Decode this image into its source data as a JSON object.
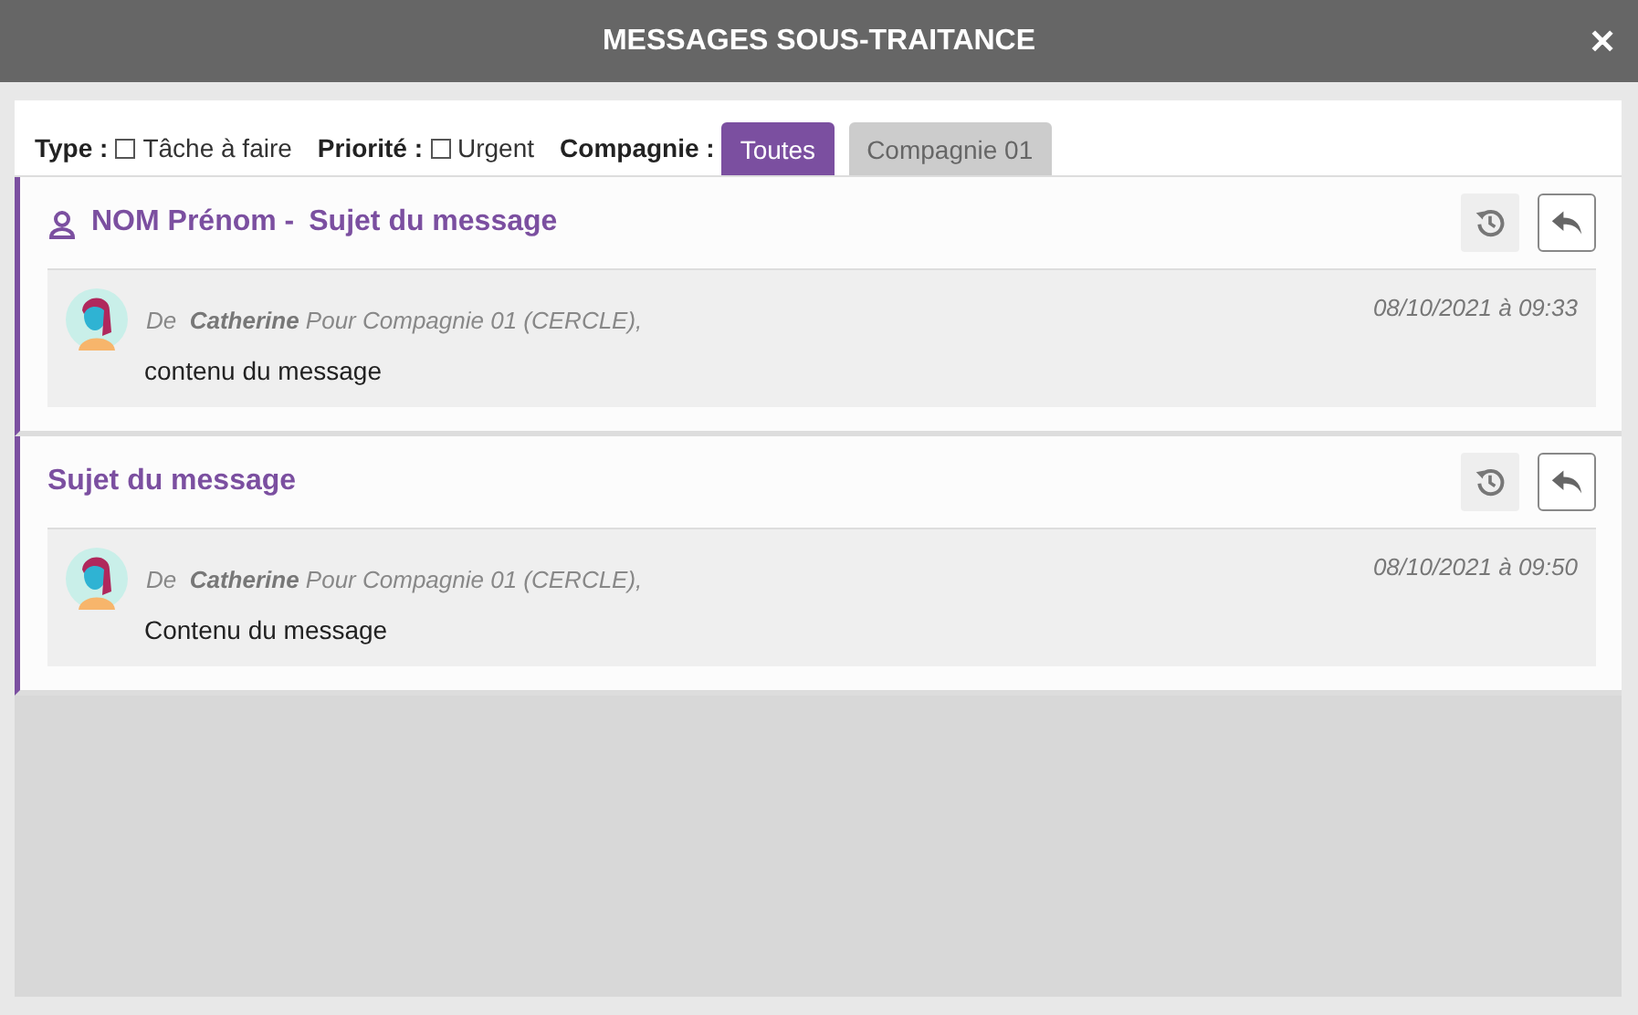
{
  "window": {
    "title": "MESSAGES SOUS-TRAITANCE",
    "close": "✕"
  },
  "filters": [
    {
      "label": "Type :",
      "option": "Tâche à faire",
      "checked": false
    },
    {
      "label": "Priorité :",
      "option": "Urgent",
      "checked": false
    }
  ],
  "company": {
    "label": "Compagnie :",
    "tabs": [
      {
        "label": "Toutes",
        "selected": true
      },
      {
        "label": "Compagnie 01",
        "selected": false
      }
    ]
  },
  "messages": [
    {
      "sender": "NOM Prénom -",
      "subject": "Sujet du message",
      "from_prefix": "De",
      "author": "Catherine",
      "recipient": "Pour Compagnie 01 (CERCLE),",
      "date": "08/10/2021 à 09:33",
      "body": "contenu du message"
    },
    {
      "subject": "Sujet du message",
      "from_prefix": "De",
      "author": "Catherine",
      "recipient": "Pour Compagnie 01 (CERCLE),",
      "date": "08/10/2021 à 09:50",
      "body": "Contenu du message"
    }
  ]
}
